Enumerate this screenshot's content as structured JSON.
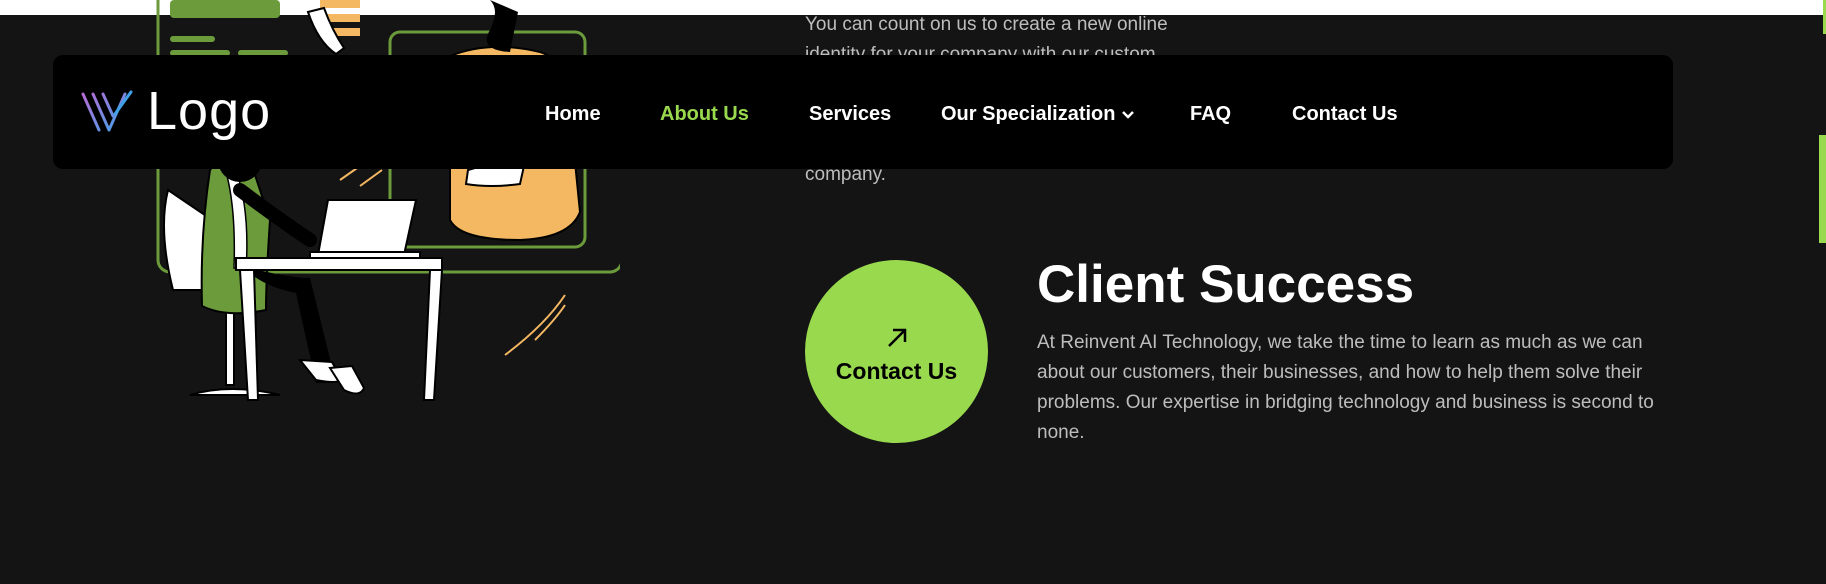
{
  "intro": {
    "text": "You can count on us to create a new online identity for your company with our custom",
    "tail": "company."
  },
  "nav": {
    "logo_text": "Logo",
    "items": [
      {
        "label": "Home"
      },
      {
        "label": "About Us"
      },
      {
        "label": "Services"
      },
      {
        "label": "Our Specialization"
      },
      {
        "label": "FAQ"
      },
      {
        "label": "Contact Us"
      }
    ],
    "active_item": "About Us"
  },
  "cta": {
    "label": "Contact Us",
    "icon": "arrow-up-right-icon"
  },
  "section": {
    "title": "Client Success",
    "body": "At Reinvent AI Technology, we take the time to learn as much as we can about our customers, their businesses, and how to help them solve their problems. Our expertise in bridging technology and business is second to none."
  },
  "colors": {
    "accent": "#99d94e",
    "background": "#141414",
    "nav_bg": "#000000",
    "illustration_orange": "#f5b862",
    "illustration_green": "#6c9b3c"
  }
}
